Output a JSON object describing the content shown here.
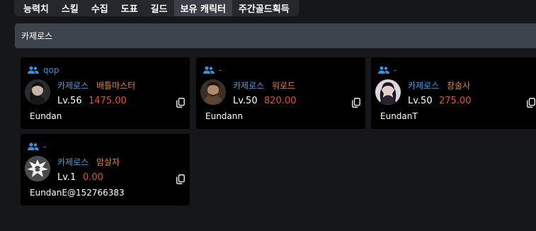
{
  "tabs": [
    {
      "label": "능력치"
    },
    {
      "label": "스킬"
    },
    {
      "label": "수집"
    },
    {
      "label": "도표"
    },
    {
      "label": "길드"
    },
    {
      "label": "보유 캐릭터"
    },
    {
      "label": "주간골드획득"
    }
  ],
  "active_tab": "보유 캐릭터",
  "section": {
    "title": "카제로스"
  },
  "characters": [
    {
      "group": "qop",
      "server": "카제로스",
      "class": "배틀마스터",
      "level": "Lv.56",
      "item_level": "1475.00",
      "name": "Eundan"
    },
    {
      "group": "-",
      "server": "카제로스",
      "class": "워로드",
      "level": "Lv.50",
      "item_level": "820.00",
      "name": "Eundann"
    },
    {
      "group": "-",
      "server": "카제로스",
      "class": "창술사",
      "level": "Lv.50",
      "item_level": "275.00",
      "name": "EundanT"
    },
    {
      "group": "-",
      "server": "카제로스",
      "class": "암살자",
      "level": "Lv.1",
      "item_level": "0.00",
      "name": "EundanE@152766383"
    }
  ],
  "colors": {
    "group": "#3d8fd6",
    "server": "#4a9fe8",
    "class": "#e08438",
    "item_level": "#e2542e"
  },
  "icons": {
    "group": "group-icon",
    "copy": "copy-icon"
  }
}
